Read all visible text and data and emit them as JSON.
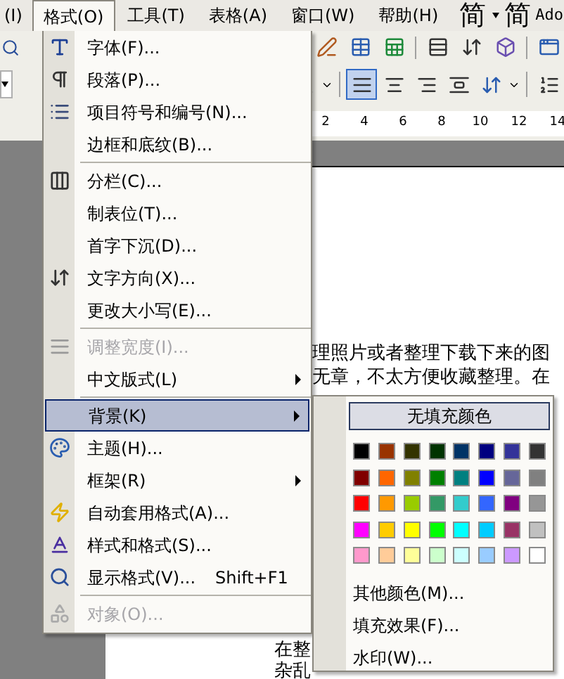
{
  "menubar": [
    {
      "label": "(I)",
      "selected": false
    },
    {
      "label": "格式(O)",
      "selected": true
    },
    {
      "label": "工具(T)",
      "selected": false
    },
    {
      "label": "表格(A)",
      "selected": false
    },
    {
      "label": "窗口(W)",
      "selected": false
    },
    {
      "label": "帮助(H)",
      "selected": false
    }
  ],
  "convert_buttons": [
    "简",
    "简"
  ],
  "menubar_cut": "Ado",
  "align_buttons": [
    {
      "selected": true
    },
    {
      "selected": false
    },
    {
      "selected": false
    },
    {
      "selected": false
    }
  ],
  "ruler": [
    "2",
    "4",
    "6",
    "8",
    "10",
    "12",
    "14"
  ],
  "menu": [
    {
      "kind": "item",
      "label": "字体(F)...",
      "disabled": false,
      "selected": false,
      "submenu": false
    },
    {
      "kind": "item",
      "label": "段落(P)...",
      "disabled": false,
      "selected": false,
      "submenu": false
    },
    {
      "kind": "item",
      "label": "项目符号和编号(N)...",
      "disabled": false,
      "selected": false,
      "submenu": false
    },
    {
      "kind": "item",
      "label": "边框和底纹(B)...",
      "disabled": false,
      "selected": false,
      "submenu": false
    },
    {
      "kind": "separator"
    },
    {
      "kind": "item",
      "label": "分栏(C)...",
      "disabled": false,
      "selected": false,
      "submenu": false
    },
    {
      "kind": "item",
      "label": "制表位(T)...",
      "disabled": false,
      "selected": false,
      "submenu": false
    },
    {
      "kind": "item",
      "label": "首字下沉(D)...",
      "disabled": false,
      "selected": false,
      "submenu": false
    },
    {
      "kind": "item",
      "label": "文字方向(X)...",
      "disabled": false,
      "selected": false,
      "submenu": false
    },
    {
      "kind": "item",
      "label": "更改大小写(E)...",
      "disabled": false,
      "selected": false,
      "submenu": false
    },
    {
      "kind": "separator"
    },
    {
      "kind": "item",
      "label": "调整宽度(I)...",
      "disabled": true,
      "selected": false,
      "submenu": false
    },
    {
      "kind": "item",
      "label": "中文版式(L)",
      "disabled": false,
      "selected": false,
      "submenu": true
    },
    {
      "kind": "separator"
    },
    {
      "kind": "item",
      "label": "背景(K)",
      "disabled": false,
      "selected": true,
      "submenu": true
    },
    {
      "kind": "item",
      "label": "主题(H)...",
      "disabled": false,
      "selected": false,
      "submenu": false
    },
    {
      "kind": "item",
      "label": "框架(R)",
      "disabled": false,
      "selected": false,
      "submenu": true
    },
    {
      "kind": "item",
      "label": "自动套用格式(A)...",
      "disabled": false,
      "selected": false,
      "submenu": false
    },
    {
      "kind": "item",
      "label": "样式和格式(S)...",
      "disabled": false,
      "selected": false,
      "submenu": false
    },
    {
      "kind": "item",
      "label": "显示格式(V)...",
      "shortcut": "Shift+F1",
      "disabled": false,
      "selected": false,
      "submenu": false
    },
    {
      "kind": "separator"
    },
    {
      "kind": "item",
      "label": "对象(O)...",
      "disabled": true,
      "selected": false,
      "submenu": false
    }
  ],
  "background_submenu": {
    "no_fill": {
      "label": "无填充颜色",
      "selected": true
    },
    "swatches": [
      {
        "color": "#000000"
      },
      {
        "color": "#993300"
      },
      {
        "color": "#333300"
      },
      {
        "color": "#003300"
      },
      {
        "color": "#003366"
      },
      {
        "color": "#000080"
      },
      {
        "color": "#333399"
      },
      {
        "color": "#333333"
      },
      {
        "color": "#800000"
      },
      {
        "color": "#ff6600"
      },
      {
        "color": "#808000"
      },
      {
        "color": "#008000"
      },
      {
        "color": "#008080"
      },
      {
        "color": "#0000ff"
      },
      {
        "color": "#666699"
      },
      {
        "color": "#808080"
      },
      {
        "color": "#ff0000"
      },
      {
        "color": "#ff9900"
      },
      {
        "color": "#99cc00"
      },
      {
        "color": "#339966"
      },
      {
        "color": "#33cccc"
      },
      {
        "color": "#3366ff"
      },
      {
        "color": "#800080"
      },
      {
        "color": "#969696"
      },
      {
        "color": "#ff00ff"
      },
      {
        "color": "#ffcc00"
      },
      {
        "color": "#ffff00"
      },
      {
        "color": "#00ff00"
      },
      {
        "color": "#00ffff"
      },
      {
        "color": "#00ccff"
      },
      {
        "color": "#993366"
      },
      {
        "color": "#c0c0c0"
      },
      {
        "color": "#ff99cc"
      },
      {
        "color": "#ffcc99"
      },
      {
        "color": "#ffff99"
      },
      {
        "color": "#ccffcc"
      },
      {
        "color": "#ccffff"
      },
      {
        "color": "#99ccff"
      },
      {
        "color": "#cc99ff"
      },
      {
        "color": "#ffffff"
      }
    ],
    "items": [
      "其他颜色(M)...",
      "填充效果(F)...",
      "水印(W)..."
    ]
  },
  "document": {
    "upper_lines": [
      "理照片或者整理下载下来的图",
      "无章，不太方便收藏整理。在"
    ],
    "lower_lines": [
      "在整",
      "杂乱"
    ]
  }
}
